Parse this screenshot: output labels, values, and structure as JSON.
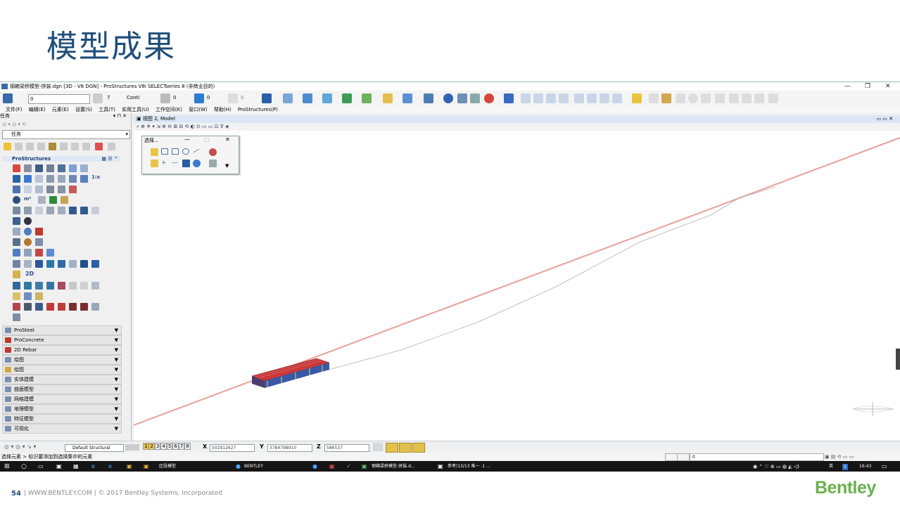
{
  "slide": {
    "title": "模型成果",
    "page_number": "54",
    "footer_text": "|  WWW.BENTLEY.COM   |   © 2017 Bentley Systems, Incorporated",
    "logo": "Bentley",
    "colors": {
      "title": "#1f4e79",
      "logo": "#6ab04c",
      "line": "#e8a09a"
    }
  },
  "app": {
    "window_title": "钢箱梁桥模型-拼装.dgn [3D - V8 DGN] - ProStructures V8i SELECTseries 8 (非商业目的)",
    "toolbar": {
      "level_combo": "0",
      "weight_value": "7",
      "style_value": "Conti",
      "line_value": "0",
      "color_value": "0",
      "trans_value": "0"
    },
    "menu": [
      "文件(F)",
      "编辑(E)",
      "元素(E)",
      "设置(S)",
      "工具(T)",
      "实用工具(U)",
      "工作空间(K)",
      "窗口(W)",
      "帮助(H)",
      "ProStructures(P)"
    ],
    "left_panel": {
      "header": "任务",
      "task_combo": "任务",
      "section": "ProStructures",
      "label_1x": "1:x",
      "label_m2": "m²",
      "label_2d": "2D",
      "categories": [
        "ProSteel",
        "ProConcrete",
        "2D Rebar",
        "绘图",
        "绘图",
        "实体建模",
        "曲面模型",
        "网格建模",
        "地理模型",
        "特征模型",
        "可视化"
      ]
    },
    "view": {
      "title": "视图 2, Model",
      "selection_dialog_title": "选择..."
    },
    "status": {
      "default_structural": "Default Structural",
      "views": [
        "1",
        "2",
        "3",
        "4",
        "5",
        "6",
        "7",
        "8"
      ],
      "x_label": "X",
      "x_value": "502912627",
      "y_label": "Y",
      "y_value": "3784798910",
      "z_label": "Z",
      "z_value": "586537",
      "message": "选择元素 > 标识要添加到选择集中的元素",
      "level_field": "0"
    },
    "taskbar": {
      "items": [
        "区段模型",
        "BENTLEY",
        "钢箱梁桥模型-拼装.d...",
        "参考(13/13 唯一 .1 ..."
      ],
      "ime": "英",
      "time": "16:43"
    }
  }
}
